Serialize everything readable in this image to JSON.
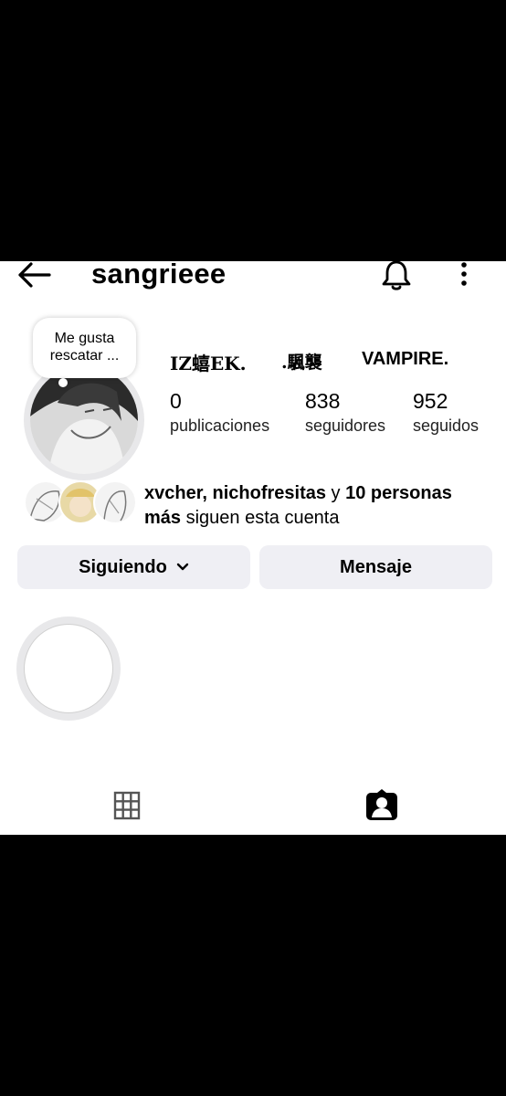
{
  "header": {
    "username": "sangrieee"
  },
  "note": {
    "text": "Me gusta rescatar ..."
  },
  "highlights": [
    {
      "label": "IZ蟢EK."
    },
    {
      "label": ".颿襲"
    },
    {
      "label": "VAMPIRE."
    }
  ],
  "stats": [
    {
      "value": "0",
      "label": "publicaciones"
    },
    {
      "value": "838",
      "label": "seguidores"
    },
    {
      "value": "952",
      "label": "seguidos"
    }
  ],
  "mutual": {
    "names": "xvcher, nichofresitas",
    "connector": " y ",
    "others": "10 personas",
    "more": "más",
    "suffix": " siguen esta cuenta"
  },
  "buttons": {
    "following": "Siguiendo",
    "message": "Mensaje"
  },
  "icons": {
    "back": "arrow-left-icon",
    "bell": "bell-icon",
    "more": "more-vertical-icon",
    "grid": "grid-icon",
    "tagged": "tagged-person-icon",
    "chevron": "chevron-down-icon"
  }
}
